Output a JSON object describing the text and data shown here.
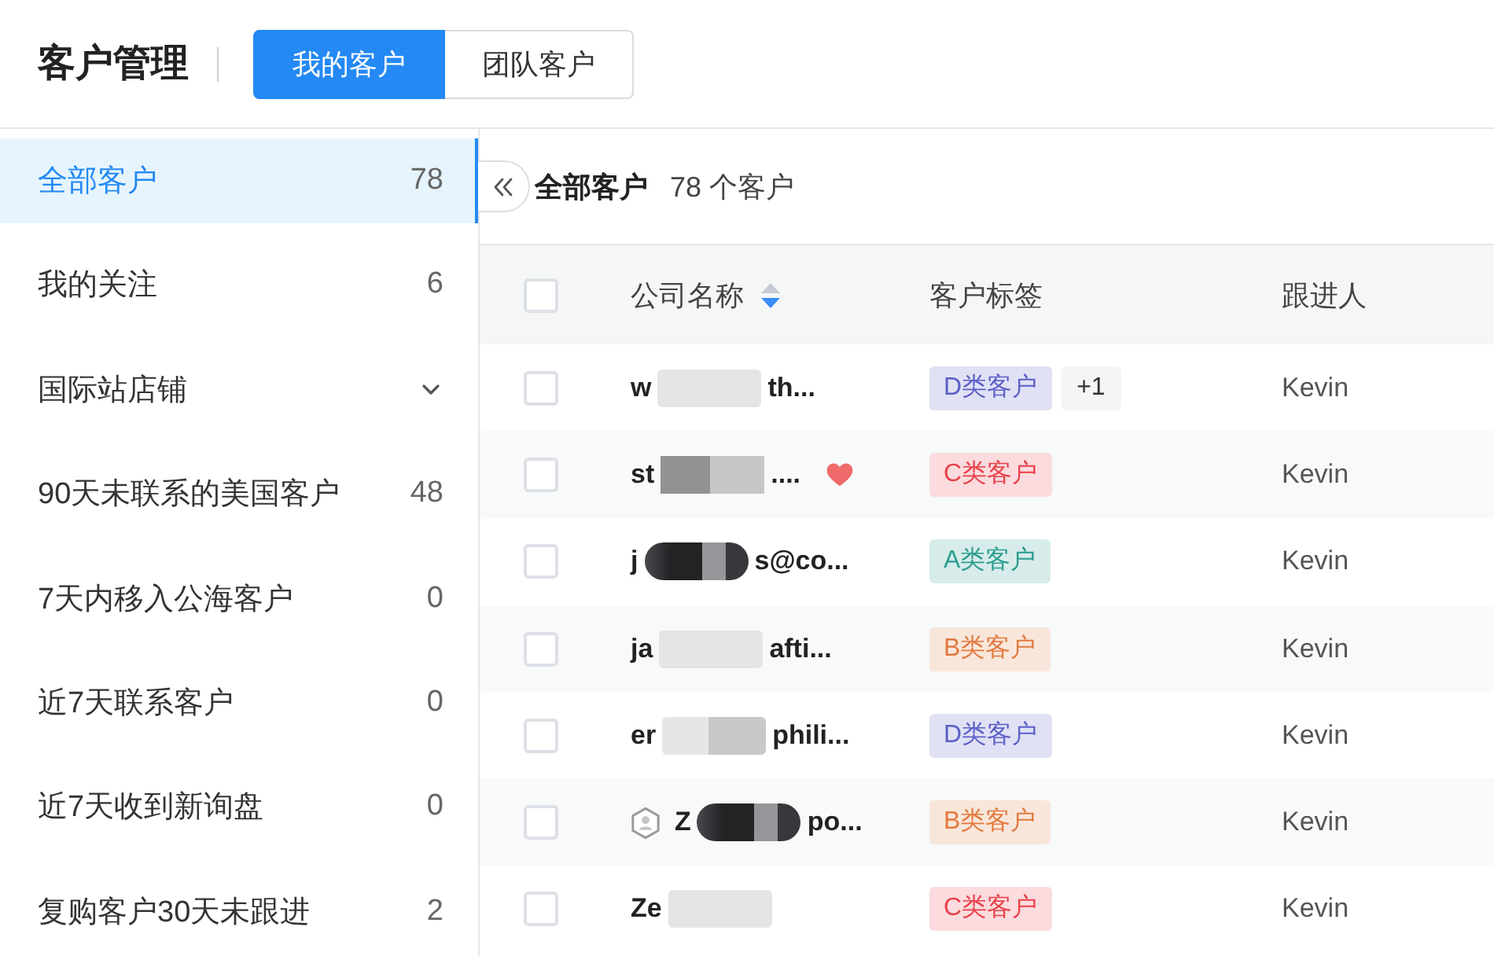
{
  "header": {
    "title": "客户管理",
    "tabs": [
      {
        "label": "我的客户",
        "selected": true
      },
      {
        "label": "团队客户",
        "selected": false
      }
    ]
  },
  "sidebar": {
    "items": [
      {
        "kind": "filter",
        "label": "全部客户",
        "count": "78",
        "selected": true
      },
      {
        "kind": "filter",
        "label": "我的关注",
        "count": "6",
        "selected": false
      },
      {
        "kind": "group",
        "label": "国际站店铺",
        "expanded": false,
        "selected": false
      },
      {
        "kind": "filter",
        "label": "90天未联系的美国客户",
        "count": "48",
        "selected": false
      },
      {
        "kind": "filter",
        "label": "7天内移入公海客户",
        "count": "0",
        "selected": false
      },
      {
        "kind": "filter",
        "label": "近7天联系客户",
        "count": "0",
        "selected": false
      },
      {
        "kind": "filter",
        "label": "近7天收到新询盘",
        "count": "0",
        "selected": false
      },
      {
        "kind": "filter",
        "label": "复购客户30天未跟进",
        "count": "2",
        "selected": false
      }
    ]
  },
  "main": {
    "title": "全部客户",
    "summary": "78 个客户",
    "table": {
      "select_all": {
        "checked": false
      },
      "columns": [
        {
          "label": "公司名称",
          "sort_descending": true
        },
        {
          "label": "客户标签"
        },
        {
          "label": "跟进人"
        }
      ],
      "rows": [
        {
          "checked": false,
          "badge": false,
          "name_start": "w",
          "redaction": {
            "kind": "light"
          },
          "name_end": "th...",
          "favorite": false,
          "tags": [
            {
              "label": "D类客户",
              "color": "#5b5fc7"
            }
          ],
          "extra_tags": "+1",
          "owner": "Kevin"
        },
        {
          "checked": false,
          "badge": false,
          "name_start": "st",
          "redaction": {
            "kind": "grey"
          },
          "name_end": "....",
          "favorite": true,
          "tags": [
            {
              "label": "C类客户",
              "color": "#e8404a"
            }
          ],
          "owner": "Kevin"
        },
        {
          "checked": false,
          "badge": false,
          "name_start": "j",
          "redaction": {
            "kind": "dark"
          },
          "name_end": "s@co...",
          "favorite": false,
          "tags": [
            {
              "label": "A类客户",
              "color": "#2a9d8f"
            }
          ],
          "owner": "Kevin"
        },
        {
          "checked": false,
          "badge": false,
          "name_start": "ja",
          "redaction": {
            "kind": "light"
          },
          "name_end": "afti...",
          "favorite": false,
          "tags": [
            {
              "label": "B类客户",
              "color": "#e27a3f"
            }
          ],
          "owner": "Kevin"
        },
        {
          "checked": false,
          "badge": false,
          "name_start": "er",
          "redaction": {
            "kind": "mixed"
          },
          "name_end": "phili...",
          "favorite": false,
          "tags": [
            {
              "label": "D类客户",
              "color": "#5b5fc7"
            }
          ],
          "owner": "Kevin"
        },
        {
          "checked": false,
          "badge": true,
          "name_start": "Z",
          "redaction": {
            "kind": "dark"
          },
          "name_end": "po...",
          "favorite": false,
          "tags": [
            {
              "label": "B类客户",
              "color": "#e27a3f"
            }
          ],
          "owner": "Kevin"
        },
        {
          "checked": false,
          "badge": false,
          "name_start": "Ze",
          "redaction": {
            "kind": "light"
          },
          "favorite": false,
          "tags": [
            {
              "label": "C类客户",
              "color": "#e8404a"
            }
          ],
          "owner": "Kevin"
        }
      ]
    }
  }
}
